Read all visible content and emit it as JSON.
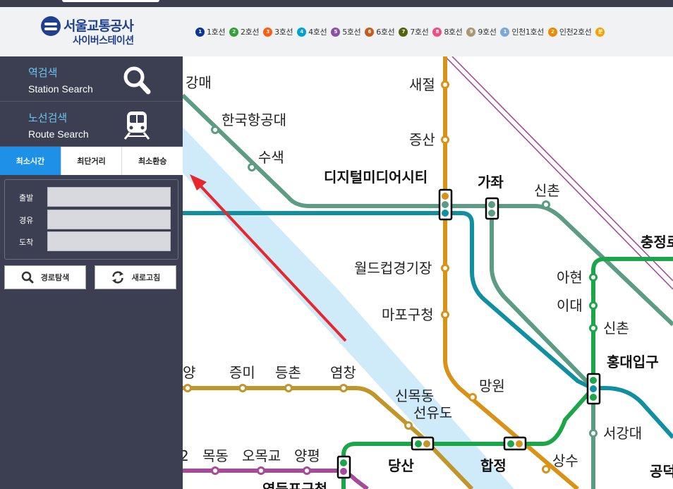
{
  "header": {
    "logo_name": "서울교통공사",
    "logo_sub": "사이버스테이션",
    "lines": [
      {
        "num": "1",
        "label": "1호선",
        "color": "#0d3692"
      },
      {
        "num": "2",
        "label": "2호선",
        "color": "#33a23d"
      },
      {
        "num": "3",
        "label": "3호선",
        "color": "#fe5d10"
      },
      {
        "num": "4",
        "label": "4호선",
        "color": "#00a2d1"
      },
      {
        "num": "5",
        "label": "5호선",
        "color": "#8b50a4"
      },
      {
        "num": "6",
        "label": "6호선",
        "color": "#c55c1d"
      },
      {
        "num": "7",
        "label": "7호선",
        "color": "#54640d"
      },
      {
        "num": "8",
        "label": "8호선",
        "color": "#f14c82"
      },
      {
        "num": "9",
        "label": "9호선",
        "color": "#aa9872"
      },
      {
        "num": "1",
        "label": "인천1호선",
        "color": "#7ca8d5"
      },
      {
        "num": "2",
        "label": "인천2호선",
        "color": "#ed8b00"
      },
      {
        "num": "분",
        "label": "",
        "color": "#f5a200"
      }
    ]
  },
  "sidebar": {
    "station_search": {
      "ko": "역검색",
      "en": "Station Search",
      "icon": "search-icon"
    },
    "route_search": {
      "ko": "노선검색",
      "en": "Route Search",
      "icon": "train-icon"
    },
    "tabs": [
      "최소시간",
      "최단거리",
      "최소환승"
    ],
    "active_tab": 0,
    "form": {
      "departure": "출발",
      "via": "경유",
      "arrival": "도착"
    },
    "search_button": "경로탐색",
    "refresh_button": "새로고침"
  },
  "map": {
    "colors": {
      "line2": "#1ca64a",
      "line3": "#d89317",
      "line6": "#b8811a",
      "gyeongui": "#5c9c84",
      "airport": "#0f8fa0",
      "line5": "#a64b9c",
      "line9": "#c9a13a",
      "arrow": "#e8262b",
      "river": "#cfeaf8"
    },
    "stations": {
      "gangmae": "강매",
      "hanguk": "한국항공대",
      "susaek": "수색",
      "saejeol": "새절",
      "jeungsan": "증산",
      "dmc": "디지털미디어시티",
      "gajwa": "가좌",
      "sinchon_gy": "신촌",
      "chungjeongro": "충정로",
      "worldcup": "월드컵경기장",
      "mapogucheong": "마포구청",
      "ahyeon": "아현",
      "idae": "이대",
      "sinchon2": "신촌",
      "hongdae": "홍대입구",
      "mangwon": "망원",
      "seogangdae": "서강대",
      "yang": "양",
      "jeungmi": "증미",
      "deungchon": "등촌",
      "yeomchang": "염창",
      "sinmokdong": "신목동",
      "seonyudo": "선유도",
      "dangsan": "당산",
      "hapjeong": "합정",
      "sangsu": "상수",
      "gongdeok": "공덕",
      "mokdong": "목동",
      "omokgyo": "오목교",
      "yangpyeong": "양평",
      "yeongdeungpo": "영등포구청",
      "num2": "2"
    }
  }
}
